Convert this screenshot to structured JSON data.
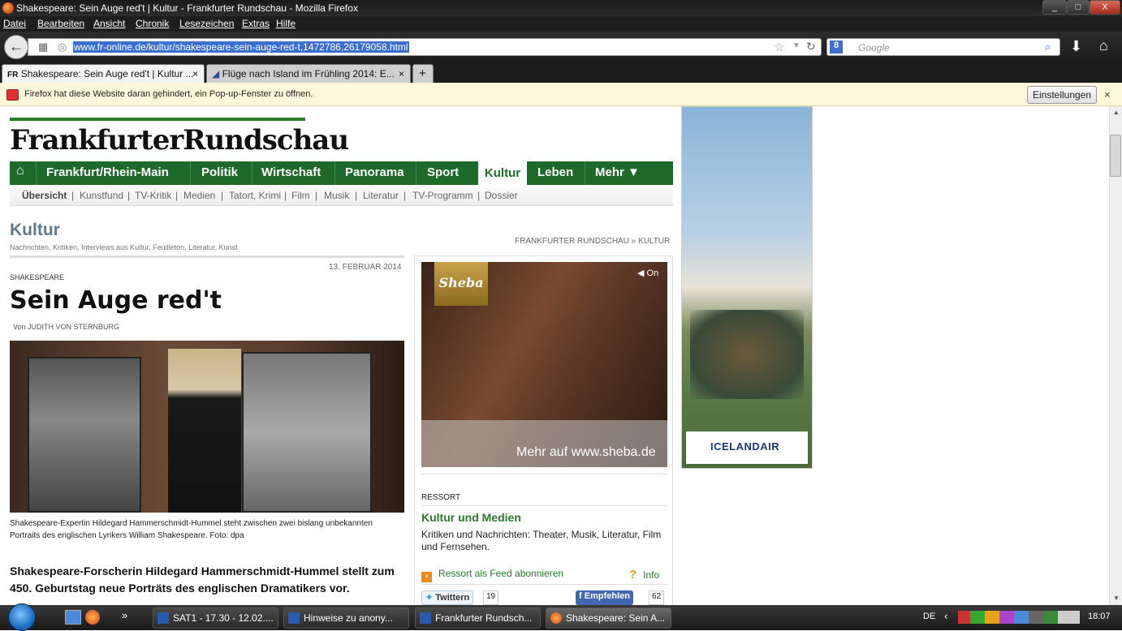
{
  "window": {
    "title": "Shakespeare: Sein Auge red't | Kultur - Frankfurter Rundschau - Mozilla Firefox",
    "min_label": "_",
    "max_label": "□",
    "close_label": "X"
  },
  "menu": [
    "Datei",
    "Bearbeiten",
    "Ansicht",
    "Chronik",
    "Lesezeichen",
    "Extras",
    "Hilfe"
  ],
  "nav": {
    "url": "www.fr-online.de/kultur/shakespeare-sein-auge-red-t,1472786,26179058.html",
    "search_placeholder": "Google",
    "back_glyph": "←"
  },
  "tabs": [
    {
      "label": "Shakespeare: Sein Auge red't | Kultur ...",
      "favicon": "FR"
    },
    {
      "label": "Flüge nach Island im Frühling 2014: E..."
    }
  ],
  "notification": {
    "message": "Firefox hat diese Website daran gehindert, ein Pop-up-Fenster zu öffnen.",
    "button": "Einstellungen",
    "close": "×"
  },
  "site": {
    "logo": "FrankfurterRundschau",
    "main_nav": [
      "Frankfurt/Rhein-Main",
      "Politik",
      "Wirtschaft",
      "Panorama",
      "Sport",
      "Kultur",
      "Leben",
      "Mehr ▼"
    ],
    "home_glyph": "⌂",
    "sub_nav": [
      "Übersicht",
      "Kunstfund",
      "TV-Kritik",
      "Medien",
      "Tatort, Krimi",
      "Film",
      "Musik",
      "Literatur",
      "TV-Programm",
      "Dossier"
    ],
    "section_title": "Kultur",
    "section_subtitle": "Nachrichten, Kritiken, Interviews aus Kultur, Feuilleton, Literatur, Kunst",
    "breadcrumb": "FRANKFURTER RUNDSCHAU » KULTUR"
  },
  "article": {
    "date": "13. FEBRUAR 2014",
    "kicker": "SHAKESPEARE",
    "headline": "Sein Auge red't",
    "author": "Von JUDITH VON STERNBURG",
    "caption": "Shakespeare-Expertin Hildegard Hammerschmidt-Hummel steht zwischen zwei bislang unbekannten Portraits des englischen Lyrikers William Shakespeare. Foto: dpa",
    "lead": "Shakespeare-Forscherin Hildegard Hammerschmidt-Hummel stellt zum 450. Geburtstag neue Porträts des englischen Dramatikers vor."
  },
  "ad": {
    "brand": "Sheba",
    "sound": "On",
    "tagline": "Mehr auf www.sheba.de"
  },
  "ressort": {
    "heading": "RESSORT",
    "title": "Kultur und Medien",
    "description": "Kritiken und Nachrichten: Theater, Musik, Literatur, Film und Fernsehen.",
    "feed": "Ressort als Feed abonnieren",
    "info": "Info",
    "twitter_label": "Twittern",
    "twitter_count": "19",
    "facebook_label": "Empfehlen",
    "facebook_count": "62"
  },
  "skyscraper": {
    "brand": "ICELANDAIR"
  },
  "taskbar": {
    "buttons": [
      "SAT1 - 17.30 - 12.02....",
      "Hinweise zu anony...",
      "Frankfurter Rundsch...",
      "Shakespeare: Sein A..."
    ],
    "lang": "DE",
    "clock": "18:07"
  }
}
